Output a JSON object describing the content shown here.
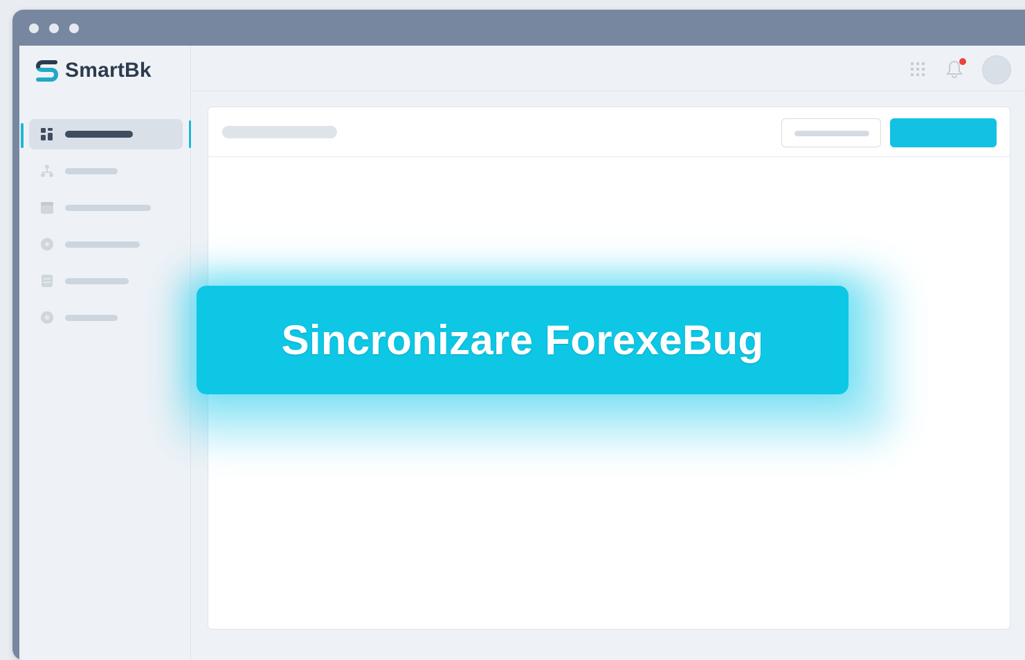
{
  "app": {
    "name": "SmartBk",
    "accent_color": "#13c2e2",
    "text_color": "#2d3b4e"
  },
  "window_controls": [
    "window-dot",
    "window-dot",
    "window-dot"
  ],
  "sidebar": {
    "items": [
      {
        "icon": "dashboard-icon",
        "active": true
      },
      {
        "icon": "hierarchy-icon",
        "active": false
      },
      {
        "icon": "calendar-icon",
        "active": false
      },
      {
        "icon": "info-circle-icon",
        "active": false
      },
      {
        "icon": "document-icon",
        "active": false
      },
      {
        "icon": "settings-circle-icon",
        "active": false
      }
    ]
  },
  "topbar": {
    "icons": [
      "apps-grid-icon",
      "notification-bell-icon"
    ],
    "notification_dot_color": "#e8443a"
  },
  "toast": {
    "message": "Sincronizare ForexeBug",
    "background_color": "#0ec7e5"
  }
}
